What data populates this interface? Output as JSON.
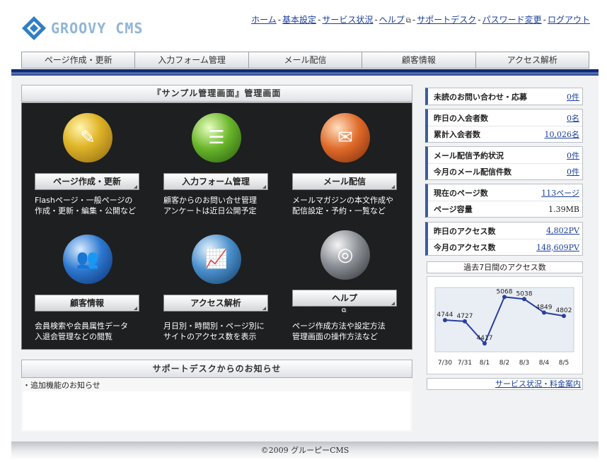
{
  "header": {
    "logo_text": "GROOVY CMS",
    "links": [
      {
        "label": "ホーム"
      },
      {
        "label": "基本設定"
      },
      {
        "label": "サービス状況"
      },
      {
        "label": "ヘルプ"
      },
      {
        "label": "サポートデスク"
      },
      {
        "label": "パスワード変更"
      },
      {
        "label": "ログアウト"
      }
    ],
    "separator": "-"
  },
  "nav": {
    "items": [
      {
        "label": "ページ作成・更新"
      },
      {
        "label": "入力フォーム管理"
      },
      {
        "label": "メール配信"
      },
      {
        "label": "顧客情報"
      },
      {
        "label": "アクセス解析"
      }
    ]
  },
  "main": {
    "title": "『サンプル管理画面』管理画面",
    "tiles": [
      {
        "button": "ページ作成・更新",
        "icon": "notebook-pencil-icon",
        "desc": [
          "Flashページ・一般ページの",
          "作成・更新・編集・公開など"
        ]
      },
      {
        "button": "入力フォーム管理",
        "icon": "form-document-icon",
        "desc": [
          "顧客からのお問い合せ管理",
          "アンケートは近日公開予定"
        ]
      },
      {
        "button": "メール配信",
        "icon": "mail-envelope-icon",
        "desc": [
          "メールマガジンの本文作成や",
          "配信設定・予約・一覧など"
        ]
      },
      {
        "button": "顧客情報",
        "icon": "users-icon",
        "desc": [
          "会員検索や会員属性データ",
          "入退会管理などの閲覧"
        ]
      },
      {
        "button": "アクセス解析",
        "icon": "chart-icon",
        "desc": [
          "月日別・時間別・ページ別に",
          "サイトのアクセス数を表示"
        ]
      },
      {
        "button": "ヘルプ",
        "icon": "lifebuoy-icon",
        "desc": [
          "ページ作成方法や設定方法",
          "管理画面の操作方法など"
        ]
      }
    ]
  },
  "support": {
    "title": "サポートデスクからのお知らせ",
    "items": [
      "・追加機能のお知らせ"
    ]
  },
  "stats": {
    "unread": {
      "label": "未読のお問い合わせ・応募",
      "value": "0件"
    },
    "members": [
      {
        "label": "昨日の入会者数",
        "value": "0名"
      },
      {
        "label": "累計入会者数",
        "value": "10,026名"
      }
    ],
    "mail": [
      {
        "label": "メール配信予約状況",
        "value": "0件"
      },
      {
        "label": "今月のメール配信件数",
        "value": "0件"
      }
    ],
    "pages": [
      {
        "label": "現在のページ数",
        "value": "113ページ"
      },
      {
        "label": "ページ容量",
        "value": "1.39MB"
      }
    ],
    "access": [
      {
        "label": "昨日のアクセス数",
        "value": "4,802PV"
      },
      {
        "label": "今月のアクセス数",
        "value": "148,609PV"
      }
    ]
  },
  "chart_data": {
    "type": "line",
    "title": "過去7日間のアクセス数",
    "categories": [
      "7/30",
      "7/31",
      "8/1",
      "8/2",
      "8/3",
      "8/4",
      "8/5"
    ],
    "values": [
      4744,
      4727,
      4417,
      5068,
      5038,
      4849,
      4802
    ],
    "ylim": [
      4300,
      5200
    ],
    "grid": false,
    "color": "#2a3fa0"
  },
  "service_link": "サービス状況・料金案内",
  "footer": {
    "copyright": "©2009 グルーピーCMS"
  }
}
